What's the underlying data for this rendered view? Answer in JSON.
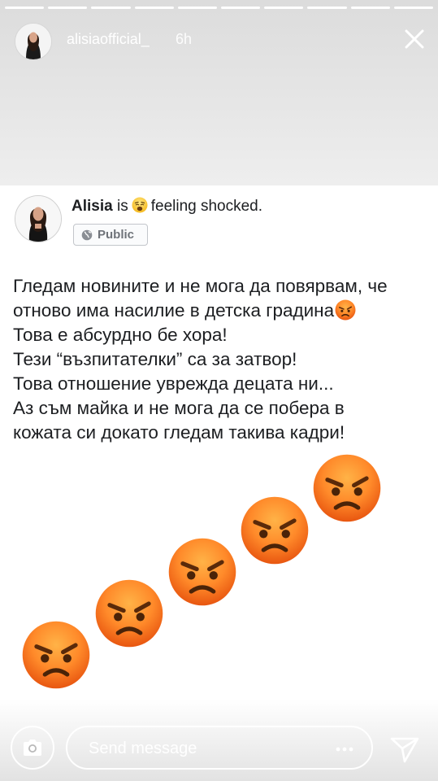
{
  "story": {
    "username": "alisiaofficial_",
    "time_ago": "6h",
    "progress_segments": 10,
    "icons": {
      "avatar": "profile-photo",
      "close": "close-icon"
    }
  },
  "post": {
    "author": "Alisia",
    "connector": "is",
    "feeling_emoji": "weary-face-emoji",
    "feeling": "feeling shocked.",
    "privacy": "Public",
    "privacy_icon": "globe-icon",
    "lines": [
      "Гледам новините и не мога да повярвам, че",
      "отново има насилие в детска градина",
      "Това е абсурдно бе хора!",
      "Тези “възпитателки” са за затвор!",
      "Това отношение уврежда децата ни...",
      "Аз съм майка и не мога да се побера в",
      "кожата си докато гледам такива кадри!"
    ],
    "inline_emoji": "angry-face-emoji",
    "angry_emoji_count": 5
  },
  "composer": {
    "placeholder": "Send message",
    "camera_icon": "camera-icon",
    "more_icon": "more-icon",
    "send_icon": "send-icon"
  },
  "colors": {
    "story_text": "#ffffff",
    "post_text": "#1c1e21",
    "badge_text": "#6f7379",
    "emoji_orange": "#f2701c",
    "emoji_yellow": "#ffb347"
  }
}
